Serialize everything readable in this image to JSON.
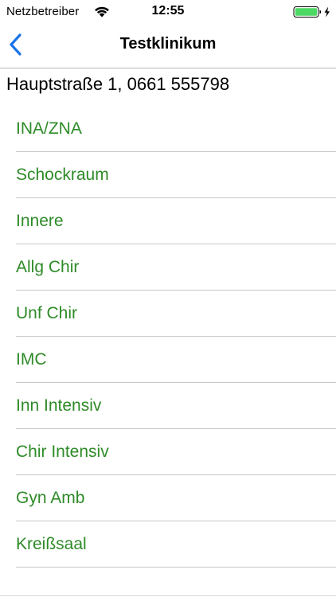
{
  "status_bar": {
    "carrier": "Netzbetreiber",
    "time": "12:55",
    "battery_color": "#4cd964",
    "wifi_icon": "wifi-icon",
    "charging_icon": "charging-bolt-icon"
  },
  "nav": {
    "title": "Testklinikum",
    "back_icon": "chevron-left-icon",
    "tint_color": "#1a73e8"
  },
  "address": "Hauptstraße 1, 0661 555798",
  "list_color": "#2e8b28",
  "departments": [
    "INA/ZNA",
    "Schockraum",
    "Innere",
    "Allg Chir",
    "Unf Chir",
    "IMC",
    "Inn Intensiv",
    "Chir Intensiv",
    "Gyn Amb",
    "Kreißsaal"
  ]
}
